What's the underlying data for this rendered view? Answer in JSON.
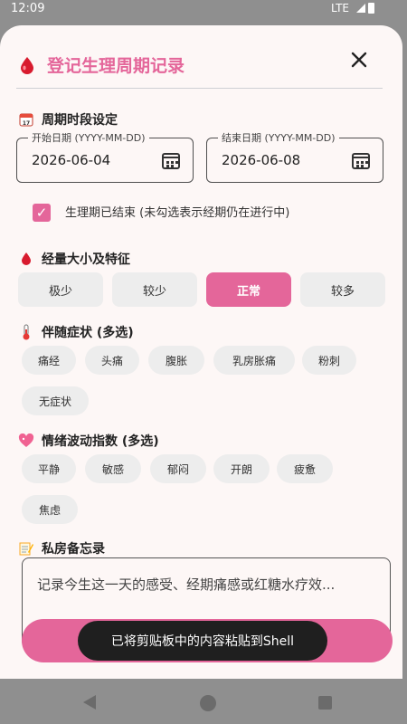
{
  "status_bar": {
    "time": "12:09",
    "network": "LTE"
  },
  "dialog": {
    "title": "登记生理周期记录",
    "close_label": "✕"
  },
  "period": {
    "section_title": "周期时段设定",
    "start": {
      "label": "开始日期 (YYYY-MM-DD)",
      "value": "2026-06-04"
    },
    "end": {
      "label": "结束日期 (YYYY-MM-DD)",
      "value": "2026-06-08"
    },
    "ended_checkbox": {
      "checked": true,
      "label": "生理期已结束 (未勾选表示经期仍在进行中)"
    }
  },
  "flow": {
    "section_title": "经量大小及特征",
    "options": [
      "极少",
      "较少",
      "正常",
      "较多"
    ],
    "selected": "正常"
  },
  "symptoms": {
    "section_title": "伴随症状 (多选)",
    "options": [
      "痛经",
      "头痛",
      "腹胀",
      "乳房胀痛",
      "粉刺",
      "无症状"
    ]
  },
  "mood": {
    "section_title": "情绪波动指数 (多选)",
    "options": [
      "平静",
      "敏感",
      "郁闷",
      "开朗",
      "疲惫",
      "焦虑"
    ]
  },
  "memo": {
    "section_title": "私房备忘录",
    "placeholder": "记录今生这一天的感受、经期痛感或红糖水疗效..."
  },
  "toast": "已将剪贴板中的内容粘贴到Shell",
  "colors": {
    "accent": "#e4669a",
    "sheet_bg": "#fdf7f6",
    "chip_bg": "#ededed"
  },
  "icons": {
    "title": "blood-drop-icon",
    "period": "calendar-icon",
    "flow": "blood-drop-icon",
    "symptoms": "thermometer-icon",
    "mood": "sparkling-heart-icon",
    "memo": "memo-icon"
  }
}
